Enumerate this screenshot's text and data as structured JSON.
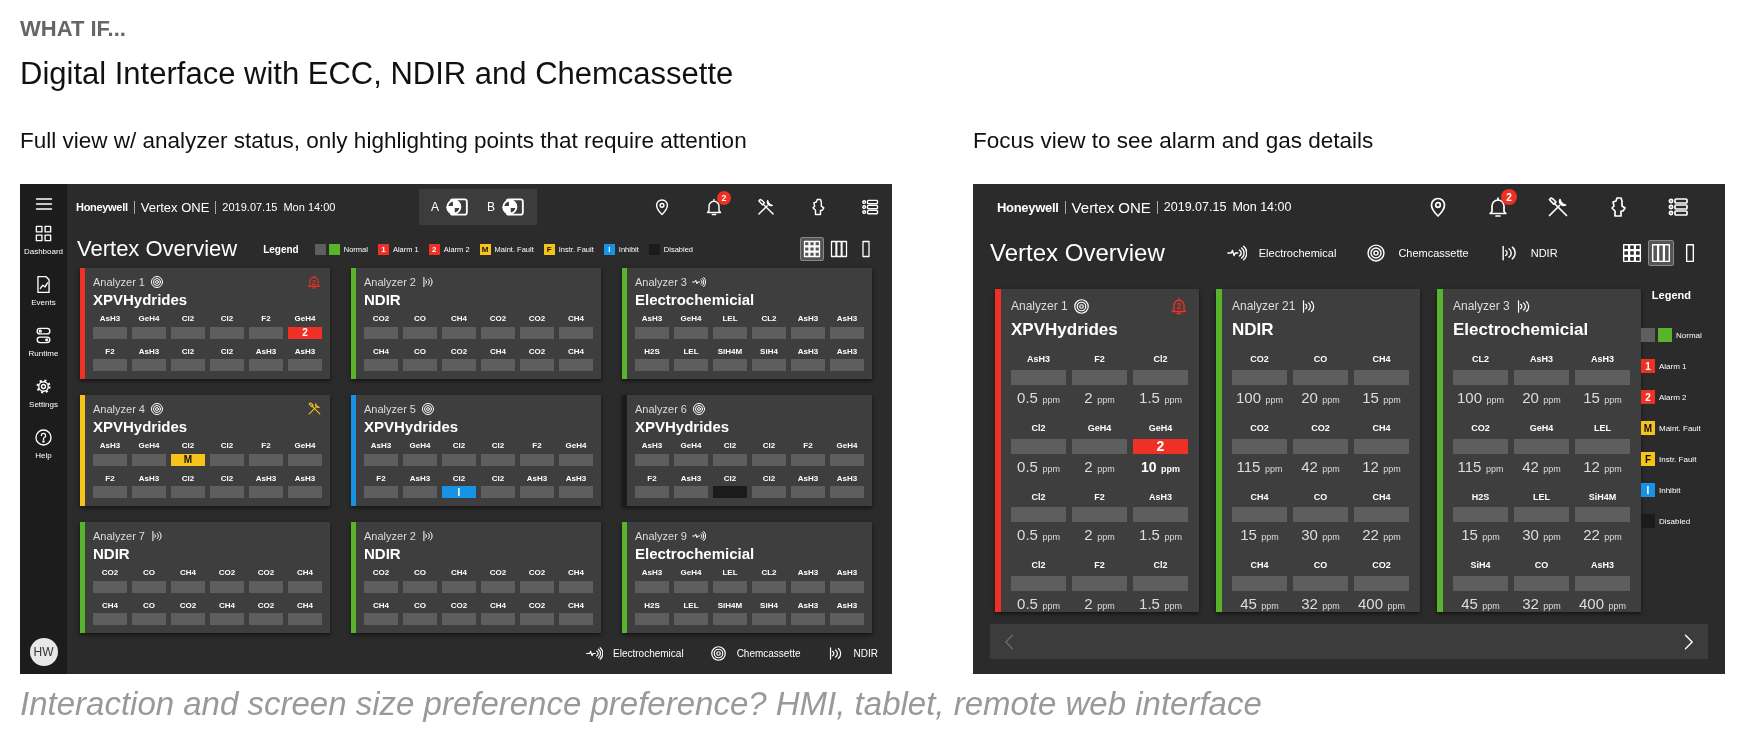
{
  "kicker": "WHAT IF...",
  "title": "Digital Interface with ECC, NDIR and Chemcassette",
  "views": [
    {
      "caption": "Full view w/ analyzer status, only highlighting points that require attention",
      "kind": "full",
      "sidebar": {
        "items": [
          {
            "label": "Dashboard"
          },
          {
            "label": "Events"
          },
          {
            "label": "Runtime"
          },
          {
            "label": "Settings"
          },
          {
            "label": "Help"
          }
        ],
        "avatar": "HW"
      },
      "header": {
        "brand": "Honeywell",
        "product": "Vertex ONE",
        "date": "2019.07.15",
        "time": "Mon 14:00",
        "notification_count": "2"
      },
      "sites": [
        {
          "label": "A"
        },
        {
          "label": "B"
        }
      ],
      "page_title": "Vertex Overview",
      "legend": {
        "title": "Legend",
        "items": [
          {
            "label": "Normal",
            "kind": "normal"
          },
          {
            "label": "Alarm 1",
            "kind": "alarm1",
            "symbol": "1"
          },
          {
            "label": "Alarm 2",
            "kind": "alarm2",
            "symbol": "2"
          },
          {
            "label": "Maint. Fault",
            "kind": "maint",
            "symbol": "M"
          },
          {
            "label": "Instr. Fault",
            "kind": "instr",
            "symbol": "F"
          },
          {
            "label": "Inhibit",
            "kind": "inhibit",
            "symbol": "I"
          },
          {
            "label": "Disabled",
            "kind": "disabled"
          }
        ]
      },
      "view_modes": [
        {
          "selected": true
        },
        {
          "selected": false
        },
        {
          "selected": false
        }
      ],
      "analyzers": [
        {
          "name": "Analyzer 1",
          "kind": "chemcassette",
          "type": "XPVHydrides",
          "color": "#ee3124",
          "alert": {
            "kind": "alarm",
            "count": "2"
          },
          "points": [
            {
              "gas": "AsH3",
              "color": "#5e5e5e"
            },
            {
              "gas": "GeH4",
              "color": "#5e5e5e"
            },
            {
              "gas": "Cl2",
              "color": "#5e5e5e"
            },
            {
              "gas": "Cl2",
              "color": "#5e5e5e"
            },
            {
              "gas": "F2",
              "color": "#5e5e5e"
            },
            {
              "gas": "GeH4",
              "color": "#ee3124",
              "symbol": "2"
            },
            {
              "gas": "F2",
              "color": "#5e5e5e"
            },
            {
              "gas": "AsH3",
              "color": "#5e5e5e"
            },
            {
              "gas": "Cl2",
              "color": "#5e5e5e"
            },
            {
              "gas": "Cl2",
              "color": "#5e5e5e"
            },
            {
              "gas": "AsH3",
              "color": "#5e5e5e"
            },
            {
              "gas": "AsH3",
              "color": "#5e5e5e"
            }
          ]
        },
        {
          "name": "Analyzer 2",
          "kind": "ndir",
          "type": "NDIR",
          "color": "#58b52b",
          "points": [
            {
              "gas": "CO2",
              "color": "#5e5e5e"
            },
            {
              "gas": "CO",
              "color": "#5e5e5e"
            },
            {
              "gas": "CH4",
              "color": "#5e5e5e"
            },
            {
              "gas": "CO2",
              "color": "#5e5e5e"
            },
            {
              "gas": "CO2",
              "color": "#5e5e5e"
            },
            {
              "gas": "CH4",
              "color": "#5e5e5e"
            },
            {
              "gas": "CH4",
              "color": "#5e5e5e"
            },
            {
              "gas": "CO",
              "color": "#5e5e5e"
            },
            {
              "gas": "CO2",
              "color": "#5e5e5e"
            },
            {
              "gas": "CH4",
              "color": "#5e5e5e"
            },
            {
              "gas": "CO2",
              "color": "#5e5e5e"
            },
            {
              "gas": "CH4",
              "color": "#5e5e5e"
            }
          ]
        },
        {
          "name": "Analyzer 3",
          "kind": "electrochemical",
          "type": "Electrochemicial",
          "color": "#58b52b",
          "points": [
            {
              "gas": "AsH3",
              "color": "#5e5e5e"
            },
            {
              "gas": "GeH4",
              "color": "#5e5e5e"
            },
            {
              "gas": "LEL",
              "color": "#5e5e5e"
            },
            {
              "gas": "CL2",
              "color": "#5e5e5e"
            },
            {
              "gas": "AsH3",
              "color": "#5e5e5e"
            },
            {
              "gas": "AsH3",
              "color": "#5e5e5e"
            },
            {
              "gas": "H2S",
              "color": "#5e5e5e"
            },
            {
              "gas": "LEL",
              "color": "#5e5e5e"
            },
            {
              "gas": "SiH4M",
              "color": "#5e5e5e"
            },
            {
              "gas": "SiH4",
              "color": "#5e5e5e"
            },
            {
              "gas": "AsH3",
              "color": "#5e5e5e"
            },
            {
              "gas": "AsH3",
              "color": "#5e5e5e"
            }
          ]
        },
        {
          "name": "Analyzer 4",
          "kind": "chemcassette",
          "type": "XPVHydrides",
          "color": "#f6c31b",
          "alert": {
            "kind": "maintenance"
          },
          "points": [
            {
              "gas": "AsH3",
              "color": "#5e5e5e"
            },
            {
              "gas": "GeH4",
              "color": "#5e5e5e"
            },
            {
              "gas": "Cl2",
              "color": "#f6c31b",
              "symbol": "M"
            },
            {
              "gas": "Cl2",
              "color": "#5e5e5e"
            },
            {
              "gas": "F2",
              "color": "#5e5e5e"
            },
            {
              "gas": "GeH4",
              "color": "#5e5e5e"
            },
            {
              "gas": "F2",
              "color": "#5e5e5e"
            },
            {
              "gas": "AsH3",
              "color": "#5e5e5e"
            },
            {
              "gas": "Cl2",
              "color": "#5e5e5e"
            },
            {
              "gas": "Cl2",
              "color": "#5e5e5e"
            },
            {
              "gas": "AsH3",
              "color": "#5e5e5e"
            },
            {
              "gas": "AsH3",
              "color": "#5e5e5e"
            }
          ]
        },
        {
          "name": "Analyzer 5",
          "kind": "chemcassette",
          "type": "XPVHydrides",
          "color": "#1792e5",
          "points": [
            {
              "gas": "AsH3",
              "color": "#5e5e5e"
            },
            {
              "gas": "GeH4",
              "color": "#5e5e5e"
            },
            {
              "gas": "Cl2",
              "color": "#5e5e5e"
            },
            {
              "gas": "Cl2",
              "color": "#5e5e5e"
            },
            {
              "gas": "F2",
              "color": "#5e5e5e"
            },
            {
              "gas": "GeH4",
              "color": "#5e5e5e"
            },
            {
              "gas": "F2",
              "color": "#5e5e5e"
            },
            {
              "gas": "AsH3",
              "color": "#5e5e5e"
            },
            {
              "gas": "Cl2",
              "color": "#1792e5",
              "symbol": "I"
            },
            {
              "gas": "Cl2",
              "color": "#5e5e5e"
            },
            {
              "gas": "AsH3",
              "color": "#5e5e5e"
            },
            {
              "gas": "AsH3",
              "color": "#5e5e5e"
            }
          ]
        },
        {
          "name": "Analyzer 6",
          "kind": "chemcassette",
          "type": "XPVHydrides",
          "color": "#1b1b1b",
          "points": [
            {
              "gas": "AsH3",
              "color": "#5e5e5e"
            },
            {
              "gas": "GeH4",
              "color": "#5e5e5e"
            },
            {
              "gas": "Cl2",
              "color": "#5e5e5e"
            },
            {
              "gas": "Cl2",
              "color": "#5e5e5e"
            },
            {
              "gas": "F2",
              "color": "#5e5e5e"
            },
            {
              "gas": "GeH4",
              "color": "#5e5e5e"
            },
            {
              "gas": "F2",
              "color": "#5e5e5e"
            },
            {
              "gas": "AsH3",
              "color": "#5e5e5e"
            },
            {
              "gas": "Cl2",
              "color": "#1b1b1b"
            },
            {
              "gas": "Cl2",
              "color": "#5e5e5e"
            },
            {
              "gas": "AsH3",
              "color": "#5e5e5e"
            },
            {
              "gas": "AsH3",
              "color": "#5e5e5e"
            }
          ]
        },
        {
          "name": "Analyzer 7",
          "kind": "ndir",
          "type": "NDIR",
          "color": "#58b52b",
          "points": [
            {
              "gas": "CO2",
              "color": "#5e5e5e"
            },
            {
              "gas": "CO",
              "color": "#5e5e5e"
            },
            {
              "gas": "CH4",
              "color": "#5e5e5e"
            },
            {
              "gas": "CO2",
              "color": "#5e5e5e"
            },
            {
              "gas": "CO2",
              "color": "#5e5e5e"
            },
            {
              "gas": "CH4",
              "color": "#5e5e5e"
            },
            {
              "gas": "CH4",
              "color": "#5e5e5e"
            },
            {
              "gas": "CO",
              "color": "#5e5e5e"
            },
            {
              "gas": "CO2",
              "color": "#5e5e5e"
            },
            {
              "gas": "CH4",
              "color": "#5e5e5e"
            },
            {
              "gas": "CO2",
              "color": "#5e5e5e"
            },
            {
              "gas": "CH4",
              "color": "#5e5e5e"
            }
          ]
        },
        {
          "name": "Analyzer 2",
          "kind": "ndir",
          "type": "NDIR",
          "color": "#58b52b",
          "points": [
            {
              "gas": "CO2",
              "color": "#5e5e5e"
            },
            {
              "gas": "CO",
              "color": "#5e5e5e"
            },
            {
              "gas": "CH4",
              "color": "#5e5e5e"
            },
            {
              "gas": "CO2",
              "color": "#5e5e5e"
            },
            {
              "gas": "CO2",
              "color": "#5e5e5e"
            },
            {
              "gas": "CH4",
              "color": "#5e5e5e"
            },
            {
              "gas": "CH4",
              "color": "#5e5e5e"
            },
            {
              "gas": "CO",
              "color": "#5e5e5e"
            },
            {
              "gas": "CO2",
              "color": "#5e5e5e"
            },
            {
              "gas": "CH4",
              "color": "#5e5e5e"
            },
            {
              "gas": "CO2",
              "color": "#5e5e5e"
            },
            {
              "gas": "CH4",
              "color": "#5e5e5e"
            }
          ]
        },
        {
          "name": "Analyzer 9",
          "kind": "electrochemical",
          "type": "Electrochemicial",
          "color": "#58b52b",
          "points": [
            {
              "gas": "AsH3",
              "color": "#5e5e5e"
            },
            {
              "gas": "GeH4",
              "color": "#5e5e5e"
            },
            {
              "gas": "LEL",
              "color": "#5e5e5e"
            },
            {
              "gas": "CL2",
              "color": "#5e5e5e"
            },
            {
              "gas": "AsH3",
              "color": "#5e5e5e"
            },
            {
              "gas": "AsH3",
              "color": "#5e5e5e"
            },
            {
              "gas": "H2S",
              "color": "#5e5e5e"
            },
            {
              "gas": "LEL",
              "color": "#5e5e5e"
            },
            {
              "gas": "SiH4M",
              "color": "#5e5e5e"
            },
            {
              "gas": "SiH4",
              "color": "#5e5e5e"
            },
            {
              "gas": "AsH3",
              "color": "#5e5e5e"
            },
            {
              "gas": "AsH3",
              "color": "#5e5e5e"
            }
          ]
        }
      ],
      "sensor_types": [
        {
          "label": "Electrochemical",
          "kind": "electrochemical"
        },
        {
          "label": "Chemcassette",
          "kind": "chemcassette"
        },
        {
          "label": "NDIR",
          "kind": "ndir"
        }
      ]
    },
    {
      "caption": "Focus view to see alarm and gas details",
      "kind": "focus",
      "header": {
        "brand": "Honeywell",
        "product": "Vertex ONE",
        "date": "2019.07.15",
        "time": "Mon 14:00",
        "notification_count": "2"
      },
      "page_title": "Vertex Overview",
      "sensor_types": [
        {
          "label": "Electrochemical",
          "kind": "electrochemical"
        },
        {
          "label": "Chemcassette",
          "kind": "chemcassette"
        },
        {
          "label": "NDIR",
          "kind": "ndir"
        }
      ],
      "view_modes": [
        {
          "selected": false
        },
        {
          "selected": true
        },
        {
          "selected": false
        }
      ],
      "analyzers": [
        {
          "name": "Analyzer 1",
          "kind": "chemcassette",
          "type": "XPVHydrides",
          "color": "#ee3124",
          "alert": {
            "kind": "alarm",
            "count": "2"
          },
          "points": [
            {
              "gas": "AsH3",
              "color": "#5e5e5e",
              "value": "0.5",
              "unit": "ppm"
            },
            {
              "gas": "F2",
              "color": "#5e5e5e",
              "value": "2",
              "unit": "ppm"
            },
            {
              "gas": "Cl2",
              "color": "#5e5e5e",
              "value": "1.5",
              "unit": "ppm"
            },
            {
              "gas": "Cl2",
              "color": "#5e5e5e",
              "value": "0.5",
              "unit": "ppm"
            },
            {
              "gas": "GeH4",
              "color": "#5e5e5e",
              "value": "2",
              "unit": "ppm"
            },
            {
              "gas": "GeH4",
              "color": "#ee3124",
              "symbol": "2",
              "value": "10",
              "unit": "ppm"
            },
            {
              "gas": "Cl2",
              "color": "#5e5e5e",
              "value": "0.5",
              "unit": "ppm"
            },
            {
              "gas": "F2",
              "color": "#5e5e5e",
              "value": "2",
              "unit": "ppm"
            },
            {
              "gas": "AsH3",
              "color": "#5e5e5e",
              "value": "1.5",
              "unit": "ppm"
            },
            {
              "gas": "Cl2",
              "color": "#5e5e5e",
              "value": "0.5",
              "unit": "ppm"
            },
            {
              "gas": "F2",
              "color": "#5e5e5e",
              "value": "2",
              "unit": "ppm"
            },
            {
              "gas": "Cl2",
              "color": "#5e5e5e",
              "value": "1.5",
              "unit": "ppm"
            }
          ]
        },
        {
          "name": "Analyzer 21",
          "kind": "ndir",
          "type": "NDIR",
          "color": "#58b52b",
          "points": [
            {
              "gas": "CO2",
              "color": "#5e5e5e",
              "value": "100",
              "unit": "ppm"
            },
            {
              "gas": "CO",
              "color": "#5e5e5e",
              "value": "20",
              "unit": "ppm"
            },
            {
              "gas": "CH4",
              "color": "#5e5e5e",
              "value": "15",
              "unit": "ppm"
            },
            {
              "gas": "CO2",
              "color": "#5e5e5e",
              "value": "115",
              "unit": "ppm"
            },
            {
              "gas": "CO2",
              "color": "#5e5e5e",
              "value": "42",
              "unit": "ppm"
            },
            {
              "gas": "CH4",
              "color": "#5e5e5e",
              "value": "12",
              "unit": "ppm"
            },
            {
              "gas": "CH4",
              "color": "#5e5e5e",
              "value": "15",
              "unit": "ppm"
            },
            {
              "gas": "CO",
              "color": "#5e5e5e",
              "value": "30",
              "unit": "ppm"
            },
            {
              "gas": "CH4",
              "color": "#5e5e5e",
              "value": "22",
              "unit": "ppm"
            },
            {
              "gas": "CH4",
              "color": "#5e5e5e",
              "value": "45",
              "unit": "ppm"
            },
            {
              "gas": "CO",
              "color": "#5e5e5e",
              "value": "32",
              "unit": "ppm"
            },
            {
              "gas": "CO2",
              "color": "#5e5e5e",
              "value": "400",
              "unit": "ppm"
            }
          ]
        },
        {
          "name": "Analyzer 3",
          "kind": "ndir",
          "type": "Electrochemicial",
          "color": "#58b52b",
          "points": [
            {
              "gas": "CL2",
              "color": "#5e5e5e",
              "value": "100",
              "unit": "ppm"
            },
            {
              "gas": "AsH3",
              "color": "#5e5e5e",
              "value": "20",
              "unit": "ppm"
            },
            {
              "gas": "AsH3",
              "color": "#5e5e5e",
              "value": "15",
              "unit": "ppm"
            },
            {
              "gas": "CO2",
              "color": "#5e5e5e",
              "value": "115",
              "unit": "ppm"
            },
            {
              "gas": "GeH4",
              "color": "#5e5e5e",
              "value": "42",
              "unit": "ppm"
            },
            {
              "gas": "LEL",
              "color": "#5e5e5e",
              "value": "12",
              "unit": "ppm"
            },
            {
              "gas": "H2S",
              "color": "#5e5e5e",
              "value": "15",
              "unit": "ppm"
            },
            {
              "gas": "LEL",
              "color": "#5e5e5e",
              "value": "30",
              "unit": "ppm"
            },
            {
              "gas": "SiH4M",
              "color": "#5e5e5e",
              "value": "22",
              "unit": "ppm"
            },
            {
              "gas": "SiH4",
              "color": "#5e5e5e",
              "value": "45",
              "unit": "ppm"
            },
            {
              "gas": "CO",
              "color": "#5e5e5e",
              "value": "32",
              "unit": "ppm"
            },
            {
              "gas": "AsH3",
              "color": "#5e5e5e",
              "value": "400",
              "unit": "ppm"
            }
          ]
        }
      ],
      "legend": {
        "title": "Legend",
        "items": [
          {
            "label": "Normal",
            "kind": "normal"
          },
          {
            "label": "Alarm 1",
            "kind": "alarm1",
            "symbol": "1"
          },
          {
            "label": "Alarm 2",
            "kind": "alarm2",
            "symbol": "2"
          },
          {
            "label": "Maint. Fault",
            "kind": "maint",
            "symbol": "M"
          },
          {
            "label": "Instr. Fault",
            "kind": "instr",
            "symbol": "F"
          },
          {
            "label": "Inhibit",
            "kind": "inhibit",
            "symbol": "I"
          },
          {
            "label": "Disabled",
            "kind": "disabled"
          }
        ]
      },
      "pager": {
        "prev_disabled": true,
        "next_disabled": false
      }
    }
  ],
  "question": "Interaction and screen size preference preference? HMI, tablet, remote web interface"
}
